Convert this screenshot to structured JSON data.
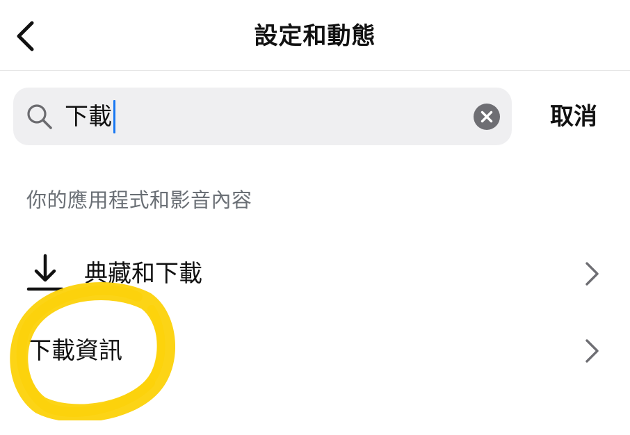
{
  "header": {
    "title": "設定和動態",
    "back_icon": "chevron-left-icon"
  },
  "search": {
    "value": "下載",
    "search_icon": "search-icon",
    "clear_icon": "clear-icon",
    "cancel_label": "取消"
  },
  "section": {
    "title": "你的應用程式和影音內容"
  },
  "results": [
    {
      "icon": "download-icon",
      "label": "典藏和下載",
      "chevron": "chevron-right-icon"
    },
    {
      "label": "下載資訊",
      "chevron": "chevron-right-icon"
    }
  ],
  "colors": {
    "caret": "#1877f2",
    "search_bg": "#efeff1",
    "highlight": "#fcd20a",
    "section_text": "#6a6f75"
  }
}
